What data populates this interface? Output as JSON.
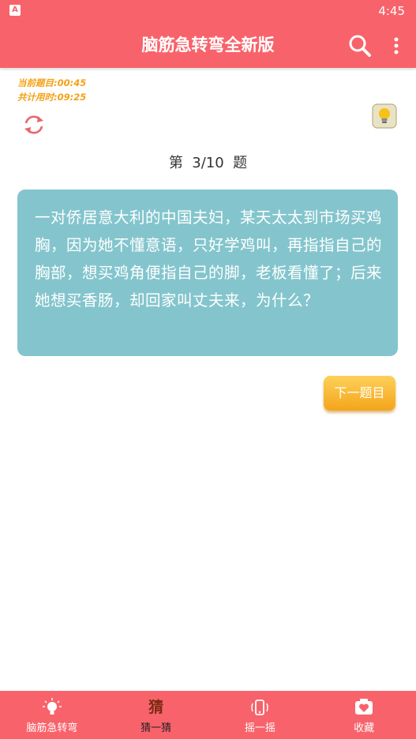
{
  "status_bar": {
    "time": "4:45",
    "app_badge": "A"
  },
  "app_bar": {
    "title": "脑筋急转弯全新版"
  },
  "timers": {
    "current": "当前题目:00:45",
    "total": "共计用时:09:25"
  },
  "question": {
    "number_label": "第  3/10  题",
    "text": "一对侨居意大利的中国夫妇，某天太太到市场买鸡胸，因为她不懂意语，只好学鸡叫，再指指自己的胸部，想买鸡角便指自己的脚，老板看懂了；后来她想买香肠，却回家叫丈夫来，为什么？"
  },
  "next_button": {
    "label": "下一题目"
  },
  "tabs": [
    {
      "label": "脑筋急转弯",
      "icon": "lightbulb-icon",
      "active": false
    },
    {
      "label": "猜一猜",
      "icon": "guess-icon",
      "active": true,
      "glyph": "猜"
    },
    {
      "label": "摇一摇",
      "icon": "shake-icon",
      "active": false
    },
    {
      "label": "收藏",
      "icon": "favorite-icon",
      "active": false
    }
  ],
  "colors": {
    "primary": "#f8636b",
    "card": "#84c5cd",
    "accent": "#f5a016"
  }
}
